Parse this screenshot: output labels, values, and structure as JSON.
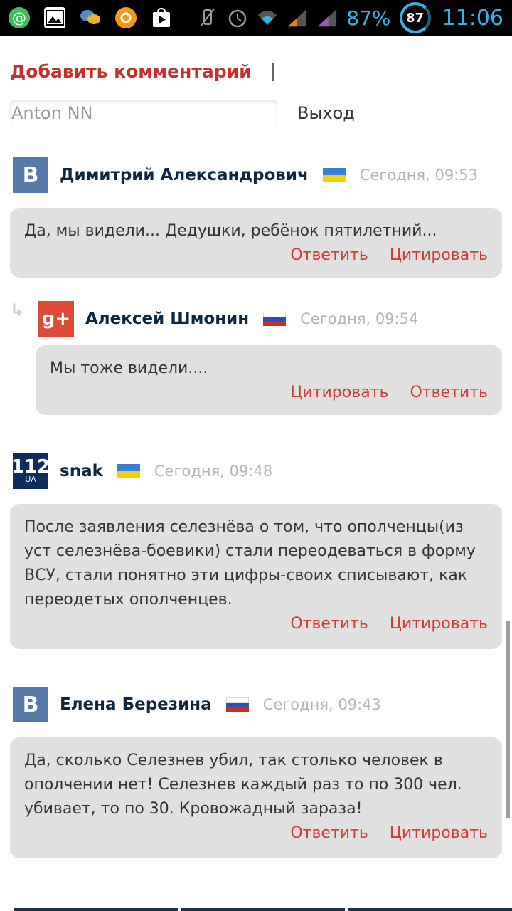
{
  "status_bar": {
    "battery": "87%",
    "battery_circle": "87",
    "time": "11:06"
  },
  "form": {
    "add_comment": "Добавить комментарий",
    "username": "Anton NN",
    "logout": "Выход"
  },
  "comments": [
    {
      "author": "Димитрий Александрович",
      "avatar": "vk-icon",
      "flag": "ua",
      "time": "Сегодня, 09:53",
      "text": "Да, мы видели... Дедушки, ребёнок пятилетний...",
      "actions": [
        "Ответить",
        "Цитировать"
      ]
    },
    {
      "author": "Алексей Шмонин",
      "avatar": "google-plus-icon",
      "flag": "ru",
      "time": "Сегодня, 09:54",
      "text": "Мы тоже видели....",
      "actions": [
        "Цитировать",
        "Ответить"
      ]
    },
    {
      "author": "snak",
      "avatar": "112ua-icon",
      "avatar_text": "112",
      "avatar_sub": "UA",
      "flag": "ua",
      "time": "Сегодня, 09:48",
      "text": "После заявления селезнёва о том, что ополченцы(из уст селезнёва-боевики) стали переодеваться в форму ВСУ, стали понятно эти цифры-своих списывают, как переодетых ополченцев.",
      "actions": [
        "Ответить",
        "Цитировать"
      ]
    },
    {
      "author": "Елена Березина",
      "avatar": "vk-icon",
      "flag": "ru",
      "time": "Сегодня, 09:43",
      "text": "Да, сколько Селезнев убил, так столько человек в ополчении нет! Селезнев каждый раз то по 300 чел. убивает, то по 30. Кровожадный зараза!",
      "actions": [
        "Ответить",
        "Цитировать"
      ]
    }
  ],
  "colors": {
    "accent_red": "#d33a32",
    "title_red": "#c9302c",
    "author_navy": "#0d2740",
    "bubble_gray": "#e0e0e0",
    "status_blue": "#33b5e5",
    "vk_blue": "#557aa7",
    "gplus_red": "#dc4a38"
  }
}
